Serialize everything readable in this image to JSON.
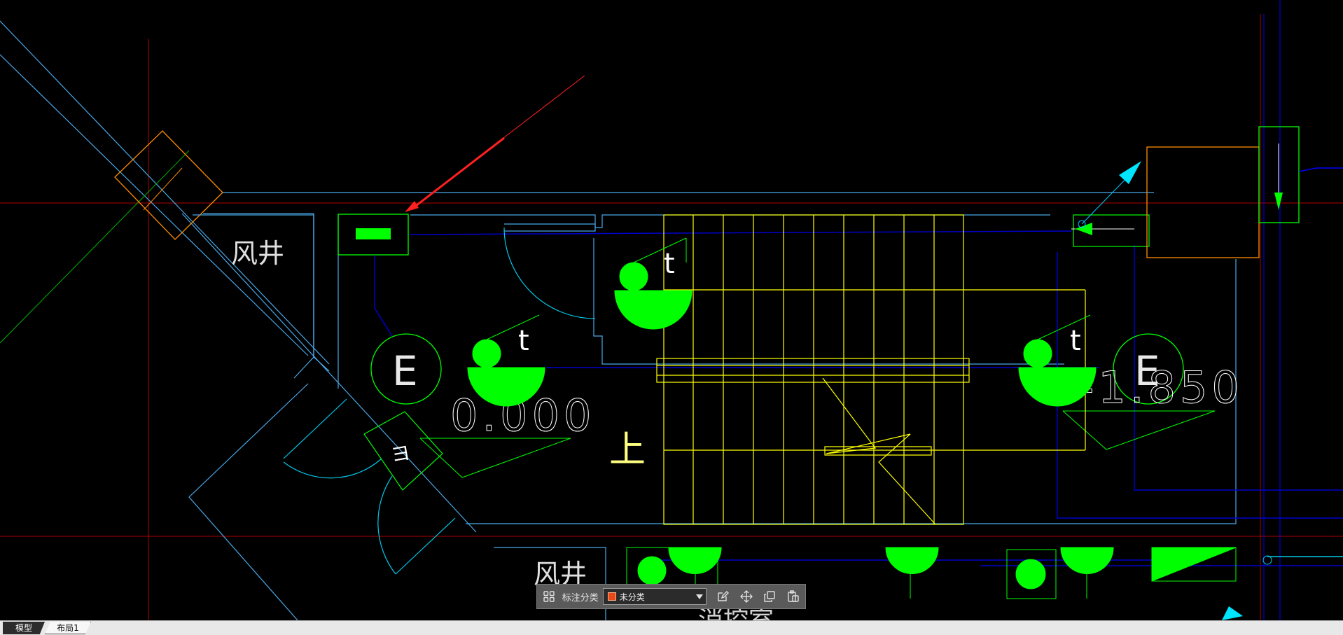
{
  "drawing": {
    "labels": {
      "shaft_top": "风井",
      "shaft_bottom": "风井",
      "axis_e1": "E",
      "axis_e2": "E",
      "elev_1": "0.000",
      "elev_2": "-1.850",
      "stair_up": "上",
      "t1": "t",
      "t2": "t",
      "t3": "t",
      "room_bottom": "消控室"
    },
    "colors": {
      "background": "#000000",
      "wall_cyan": "#00ffff",
      "grid_red": "#c00000",
      "stair_yellow": "#ffff00",
      "symbol_green": "#00ff00",
      "line_blue": "#0000ff",
      "arrow_red": "#ff2020",
      "orange": "#ff8c00"
    }
  },
  "toolbar": {
    "label": "标注分类",
    "selected_category": "未分类",
    "swatch_color": "#e64a19",
    "icons": [
      "category-grid-icon",
      "edit-icon",
      "move-icon",
      "copy-icon",
      "paste-icon"
    ]
  },
  "tabs": {
    "model": "模型",
    "layout1": "布局1"
  }
}
